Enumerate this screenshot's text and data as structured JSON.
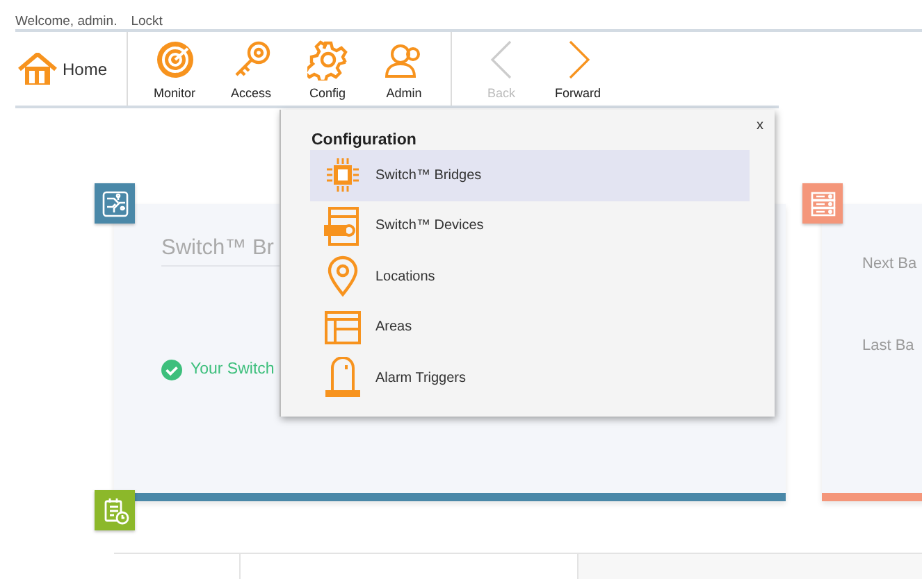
{
  "header": {
    "welcome": "Welcome, admin.",
    "app_name": "Lockt"
  },
  "toolbar": {
    "home": "Home",
    "modules": [
      {
        "label": "Monitor",
        "kind": "monitor"
      },
      {
        "label": "Access",
        "kind": "access"
      },
      {
        "label": "Config",
        "kind": "config"
      },
      {
        "label": "Admin",
        "kind": "admin"
      }
    ],
    "history": [
      {
        "label": "Back",
        "kind": "back",
        "disabled": true
      },
      {
        "label": "Forward",
        "kind": "forward",
        "disabled": false
      }
    ]
  },
  "cards": [
    {
      "kind": "bridges",
      "title": "Switch™ Br",
      "status": "Your Switch"
    },
    {
      "kind": "backup",
      "lines": [
        "Next Ba",
        "Last Ba"
      ]
    }
  ],
  "config_menu": {
    "title": "Configuration",
    "close": "x",
    "items": [
      {
        "label": "Switch™ Bridges",
        "kind": "chip",
        "selected": true
      },
      {
        "label": "Switch™ Devices",
        "kind": "device",
        "selected": false
      },
      {
        "label": "Locations",
        "kind": "pin",
        "selected": false
      },
      {
        "label": "Areas",
        "kind": "areas",
        "selected": false
      },
      {
        "label": "Alarm Triggers",
        "kind": "trigger",
        "selected": false
      }
    ]
  }
}
